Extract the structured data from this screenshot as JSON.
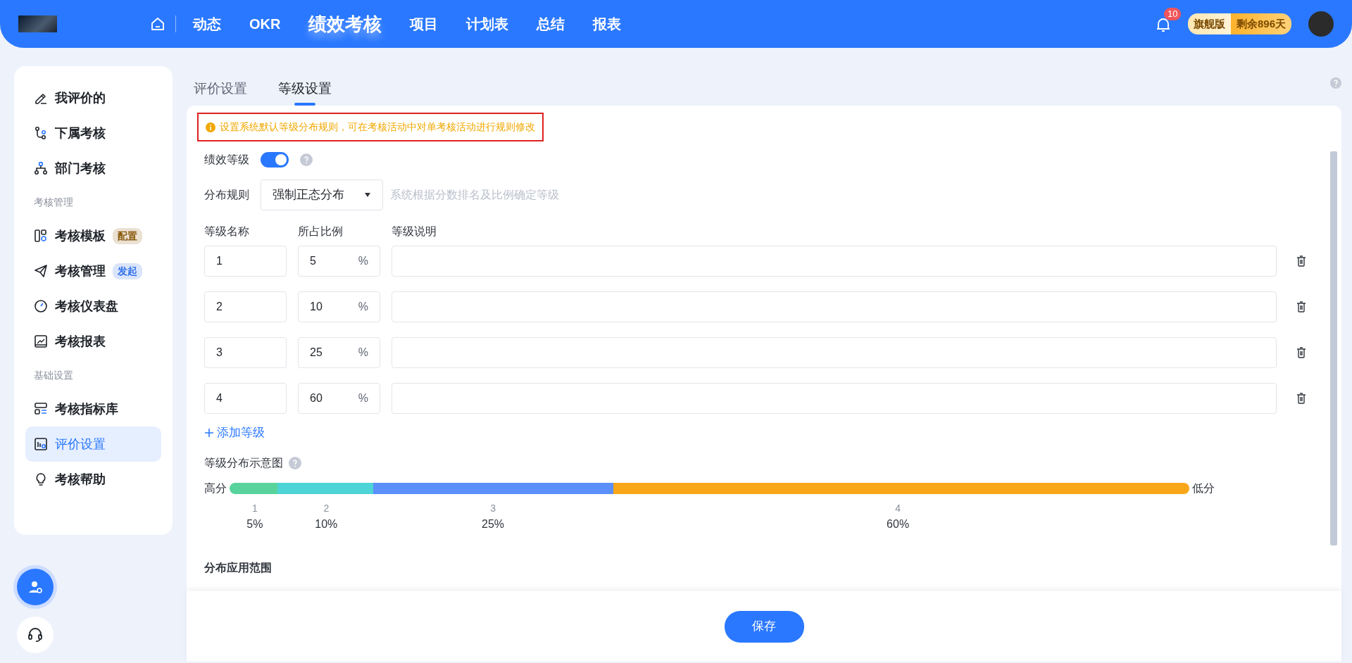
{
  "header": {
    "nav": [
      {
        "label": "动态",
        "selected": false
      },
      {
        "label": "OKR",
        "selected": false
      },
      {
        "label": "绩效考核",
        "selected": true
      },
      {
        "label": "项目",
        "selected": false
      },
      {
        "label": "计划表",
        "selected": false
      },
      {
        "label": "总结",
        "selected": false
      },
      {
        "label": "报表",
        "selected": false
      }
    ],
    "notifications": {
      "count": "10"
    },
    "plan": {
      "edition": "旗舰版",
      "remaining": "剩余896天"
    }
  },
  "sidebar": {
    "items": [
      {
        "kind": "item",
        "label": "我评价的",
        "selected": false
      },
      {
        "kind": "item",
        "label": "下属考核",
        "selected": false
      },
      {
        "kind": "item",
        "label": "部门考核",
        "selected": false
      },
      {
        "kind": "section",
        "label": "考核管理"
      },
      {
        "kind": "item",
        "label": "考核模板",
        "selected": false,
        "badge": {
          "text": "配置",
          "color": "#8a5a0c"
        }
      },
      {
        "kind": "item",
        "label": "考核管理",
        "selected": false,
        "badge": {
          "text": "发起",
          "color": "#2f6fe8"
        }
      },
      {
        "kind": "item",
        "label": "考核仪表盘",
        "selected": false
      },
      {
        "kind": "item",
        "label": "考核报表",
        "selected": false
      },
      {
        "kind": "section",
        "label": "基础设置"
      },
      {
        "kind": "item",
        "label": "考核指标库",
        "selected": false
      },
      {
        "kind": "item",
        "label": "评价设置",
        "selected": true
      },
      {
        "kind": "item",
        "label": "考核帮助",
        "selected": false
      }
    ]
  },
  "tabs": [
    {
      "label": "评价设置",
      "selected": false
    },
    {
      "label": "等级设置",
      "selected": true
    }
  ],
  "notice": {
    "text": "设置系统默认等级分布规则，可在考核活动中对单考核活动进行规则修改"
  },
  "performance_grade": {
    "label": "绩效等级",
    "on": true
  },
  "distribution_rule": {
    "label": "分布规则",
    "value": "强制正态分布",
    "hint": "系统根据分数排名及比例确定等级"
  },
  "grade_table": {
    "columns": [
      "等级名称",
      "所占比例",
      "等级说明"
    ],
    "rows": [
      {
        "name": "1",
        "ratio": "5",
        "unit": "%"
      },
      {
        "name": "2",
        "ratio": "10",
        "unit": "%"
      },
      {
        "name": "3",
        "ratio": "25",
        "unit": "%"
      },
      {
        "name": "4",
        "ratio": "60",
        "unit": "%"
      }
    ]
  },
  "add_grade": {
    "label": "添加等级"
  },
  "distribution_chart": {
    "title": "等级分布示意图",
    "high_label": "高分",
    "low_label": "低分",
    "segments": [
      {
        "grade": "1",
        "percent": "5%",
        "color": "#58d39c"
      },
      {
        "grade": "2",
        "percent": "10%",
        "color": "#4dd4d6"
      },
      {
        "grade": "3",
        "percent": "25%",
        "color": "#5b8ff9"
      },
      {
        "grade": "4",
        "percent": "60%",
        "color": "#faa619"
      }
    ]
  },
  "scope_section": {
    "title": "分布应用范围"
  },
  "save_button": {
    "label": "保存"
  }
}
